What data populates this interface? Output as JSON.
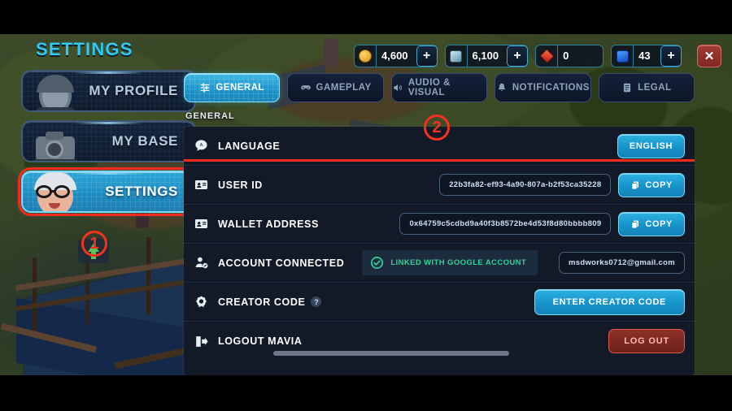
{
  "sidebar": {
    "title": "SETTINGS",
    "items": [
      {
        "label": "MY PROFILE",
        "active": false
      },
      {
        "label": "MY BASE",
        "active": false
      },
      {
        "label": "SETTINGS",
        "active": true
      }
    ]
  },
  "annotations": [
    {
      "id": "1",
      "target": "settings-sidebar-button"
    },
    {
      "id": "2",
      "target": "language-row"
    }
  ],
  "resources": [
    {
      "name": "gold",
      "icon": "coin-icon",
      "value": "4,600",
      "add": "+"
    },
    {
      "name": "food",
      "icon": "food-icon",
      "value": "6,100",
      "add": "+"
    },
    {
      "name": "ruby",
      "icon": "ruby-icon",
      "value": "0",
      "add": ""
    },
    {
      "name": "gem",
      "icon": "gem-icon",
      "value": "43",
      "add": "+"
    }
  ],
  "close_label": "✕",
  "tabs": [
    {
      "label": "GENERAL",
      "icon": "sliders-icon",
      "active": true
    },
    {
      "label": "GAMEPLAY",
      "icon": "gamepad-icon",
      "active": false
    },
    {
      "label": "AUDIO & VISUAL",
      "icon": "speaker-icon",
      "active": false
    },
    {
      "label": "NOTIFICATIONS",
      "icon": "bell-icon",
      "active": false
    },
    {
      "label": "LEGAL",
      "icon": "book-icon",
      "active": false
    }
  ],
  "section_label": "GENERAL",
  "rows": {
    "language": {
      "label": "LANGUAGE",
      "icon": "speech-bubble-icon",
      "button": "ENGLISH"
    },
    "user_id": {
      "label": "USER ID",
      "icon": "id-card-icon",
      "value": "22b3fa82-ef93-4a90-807a-b2f53ca35228",
      "button": "COPY"
    },
    "wallet": {
      "label": "WALLET ADDRESS",
      "icon": "id-card-icon",
      "value": "0x64759c5cdbd9a40f3b8572be4d53f8d80bbbb809",
      "button": "COPY"
    },
    "account": {
      "label": "ACCOUNT CONNECTED",
      "icon": "person-badge-icon",
      "status": "LINKED WITH GOOGLE ACCOUNT",
      "email": "msdworks0712@gmail.com"
    },
    "creator": {
      "label": "CREATOR CODE",
      "icon": "creator-gear-icon",
      "help": "?",
      "button": "ENTER CREATOR CODE"
    },
    "logout": {
      "label": "LOGOUT MAVIA",
      "icon": "logout-icon",
      "button": "LOG OUT"
    }
  },
  "colors": {
    "accent_blue": "#189fd4",
    "title_cyan": "#31c8f4",
    "highlight_red": "#f42b1a",
    "linked_green": "#2fd396",
    "panel_bg": "#121a28",
    "logout_red": "#8e3129"
  }
}
